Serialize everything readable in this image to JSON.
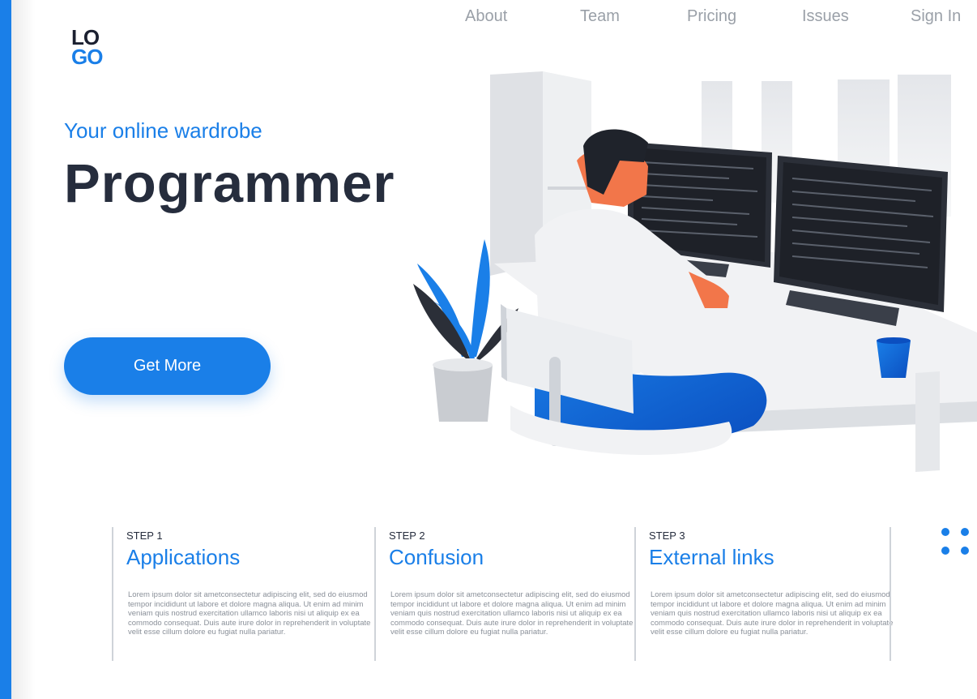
{
  "logo": {
    "line1": "LO",
    "line2": "GO"
  },
  "nav": [
    "About",
    "Team",
    "Pricing",
    "Issues",
    "Sign In"
  ],
  "hero": {
    "tagline": "Your online wardrobe",
    "title": "Programmer",
    "cta": "Get More"
  },
  "steps": [
    {
      "label": "Step 1",
      "title": "Applications",
      "body": "Lorem ipsum dolor sit ametconsectetur adipiscing elit, sed do eiusmod tempor incididunt ut labore et dolore magna aliqua. Ut enim ad minim veniam quis nostrud exercitation ullamco laboris nisi ut aliquip ex ea commodo consequat. Duis aute irure dolor in reprehenderit in voluptate velit esse cillum dolore eu fugiat nulla pariatur."
    },
    {
      "label": "Step 2",
      "title": "Confusion",
      "body": "Lorem ipsum dolor sit ametconsectetur adipiscing elit, sed do eiusmod tempor incididunt ut labore et dolore magna aliqua. Ut enim ad minim veniam quis nostrud exercitation ullamco laboris nisi ut aliquip ex ea commodo consequat. Duis aute irure dolor in reprehenderit in voluptate velit esse cillum dolore eu fugiat nulla pariatur."
    },
    {
      "label": "Step 3",
      "title": "External links",
      "body": "Lorem ipsum dolor sit ametconsectetur adipiscing elit, sed do eiusmod tempor incididunt ut labore et dolore magna aliqua. Ut enim ad minim veniam quis nostrud exercitation ullamco laboris nisi ut aliquip ex ea commodo consequat. Duis aute irure dolor in reprehenderit in voluptate velit esse cillum dolore eu fugiat nulla pariatur."
    }
  ],
  "colors": {
    "accent": "#1a7fe8",
    "text": "#262d3d",
    "muted": "#9aa0a8"
  }
}
